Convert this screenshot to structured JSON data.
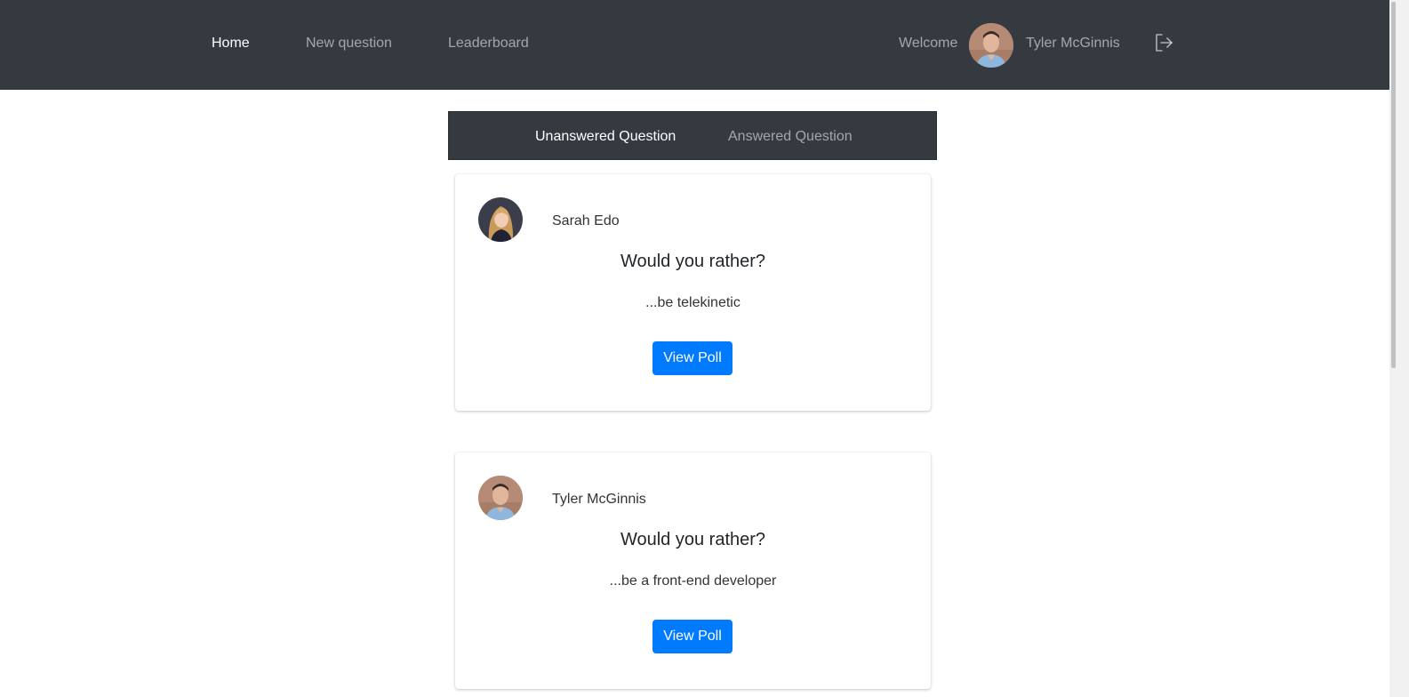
{
  "navbar": {
    "links": [
      {
        "label": "Home",
        "active": true
      },
      {
        "label": "New question",
        "active": false
      },
      {
        "label": "Leaderboard",
        "active": false
      }
    ],
    "welcome_label": "Welcome",
    "username": "Tyler McGinnis",
    "logout_icon": "logout-icon"
  },
  "tabs": [
    {
      "label": "Unanswered Question",
      "active": true
    },
    {
      "label": "Answered Question",
      "active": false
    }
  ],
  "questions": [
    {
      "author": "Sarah Edo",
      "title": "Would you rather?",
      "option": "...be telekinetic",
      "button_label": "View Poll"
    },
    {
      "author": "Tyler McGinnis",
      "title": "Would you rather?",
      "option": "...be a front-end developer",
      "button_label": "View Poll"
    }
  ],
  "colors": {
    "navbar_bg": "#343a40",
    "primary_button": "#007bff"
  }
}
